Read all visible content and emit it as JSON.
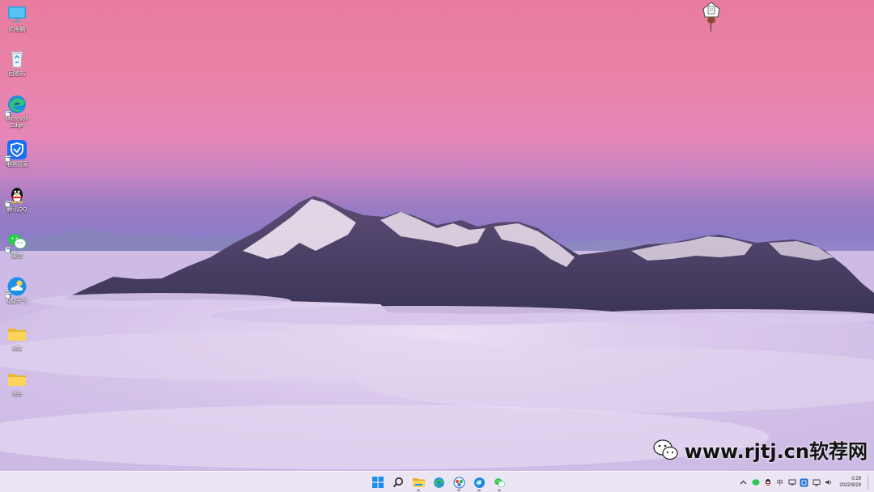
{
  "desktop": {
    "icons": [
      {
        "id": "pc",
        "label": "此电脑",
        "icon": "monitor-icon",
        "shortcut": false
      },
      {
        "id": "recycle",
        "label": "回收站",
        "icon": "recycle-bin-icon",
        "shortcut": false
      },
      {
        "id": "edge",
        "label": "Microsoft Edge",
        "icon": "edge-icon",
        "shortcut": true
      },
      {
        "id": "tencent",
        "label": "电脑管家",
        "icon": "tencent-guard-icon",
        "shortcut": true
      },
      {
        "id": "qq",
        "label": "腾讯QQ",
        "icon": "qq-penguin-icon",
        "shortcut": true
      },
      {
        "id": "wechat",
        "label": "微信",
        "icon": "wechat-icon",
        "shortcut": true
      },
      {
        "id": "weather",
        "label": "QQ天气",
        "icon": "weather-icon",
        "shortcut": true
      },
      {
        "id": "folder1",
        "label": "666",
        "icon": "folder-icon",
        "shortcut": false
      },
      {
        "id": "folder2",
        "label": "999",
        "icon": "folder-icon",
        "shortcut": false
      }
    ]
  },
  "watermark": {
    "text": "www.rjtj.cn软荐网"
  },
  "taskbar": {
    "apps": [
      {
        "id": "start",
        "icon": "windows-start-icon",
        "running": false
      },
      {
        "id": "search",
        "icon": "search-icon",
        "running": false
      },
      {
        "id": "explorer",
        "icon": "file-explorer-icon",
        "running": true
      },
      {
        "id": "edge",
        "icon": "edge-icon",
        "running": false
      },
      {
        "id": "app5",
        "icon": "chrome-like-icon",
        "running": true
      },
      {
        "id": "app6",
        "icon": "browser-icon",
        "running": true
      },
      {
        "id": "wechat",
        "icon": "wechat-icon",
        "running": true
      }
    ],
    "tray": {
      "icons": [
        "chevron-up-icon",
        "wechat-tray-icon",
        "qq-tray-icon",
        "ime-icon",
        "network-icon",
        "blue-app-icon",
        "monitor-tray-icon",
        "speaker-icon"
      ],
      "ime_label": "中",
      "time": "0:29",
      "date": "2022/9/29"
    }
  },
  "colors": {
    "sky_top": "#e77fa5",
    "sky_mid": "#e882b4",
    "sky_low": "#8a78c8",
    "clouds": "#d8c6ec",
    "taskbar": "#ece6f4"
  }
}
